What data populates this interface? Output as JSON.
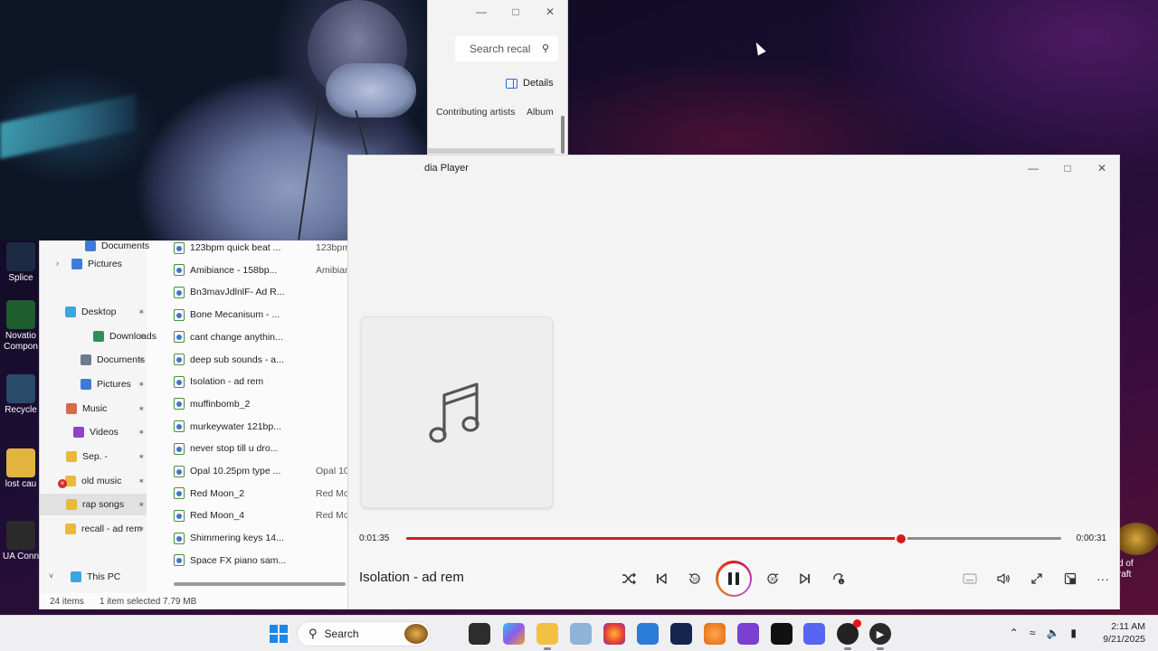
{
  "desktop": {
    "icons": [
      {
        "label": "Splice",
        "color": "#1d2a44"
      },
      {
        "label": "Novatio Compon",
        "color": "#1d5d2e"
      },
      {
        "label": "Recycle",
        "color": "#2a4a6a"
      },
      {
        "label": "lost cau",
        "color": "#e3b341"
      },
      {
        "label": "UA Conn",
        "color": "#2a2a2a"
      }
    ],
    "right_icon_label": "d of\nraft"
  },
  "top_explorer": {
    "search_placeholder": "Search recal",
    "details_label": "Details",
    "columns": [
      "Contributing artists",
      "Album"
    ]
  },
  "explorer": {
    "nav_items": [
      {
        "label": "Documents",
        "icon_color": "#3d7bd9",
        "pinned": false
      },
      {
        "label": "Pictures",
        "icon_color": "#3d7bd9",
        "pinned": false
      },
      {
        "label": "Desktop",
        "icon_color": "#3aa5de",
        "pinned": true
      },
      {
        "label": "Downloads",
        "icon_color": "#2e8f5c",
        "pinned": true
      },
      {
        "label": "Documents",
        "icon_color": "#6d7b8d",
        "pinned": true
      },
      {
        "label": "Pictures",
        "icon_color": "#3d7bd9",
        "pinned": true
      },
      {
        "label": "Music",
        "icon_color": "#d46b4a",
        "pinned": true
      },
      {
        "label": "Videos",
        "icon_color": "#8c44c8",
        "pinned": true
      },
      {
        "label": "Sep. -",
        "icon_color": "#e9b93a",
        "pinned": true
      },
      {
        "label": "old music",
        "icon_color": "#e9b93a",
        "pinned": true
      },
      {
        "label": "rap songs",
        "icon_color": "#e9b93a",
        "pinned": true
      },
      {
        "label": "recall - ad rem",
        "icon_color": "#e9b93a",
        "pinned": true
      },
      {
        "label": "This PC",
        "icon_color": "#3aa5de",
        "pinned": false
      }
    ],
    "files": [
      {
        "name": "123bpm quick beat ...",
        "album": "123bpm"
      },
      {
        "name": "Amibiance - 158bp...",
        "album": "Amibian"
      },
      {
        "name": "Bn3mavJdlnlF- Ad R...",
        "album": ""
      },
      {
        "name": "Bone Mecanisum - ...",
        "album": ""
      },
      {
        "name": "cant change anythin...",
        "album": ""
      },
      {
        "name": "deep sub sounds - a...",
        "album": ""
      },
      {
        "name": "Isolation - ad rem",
        "album": ""
      },
      {
        "name": "muffinbomb_2",
        "album": ""
      },
      {
        "name": "murkeywater 121bp...",
        "album": ""
      },
      {
        "name": "never stop till u dro...",
        "album": ""
      },
      {
        "name": "Opal 10.25pm type ...",
        "album": "Opal 10."
      },
      {
        "name": "Red Moon_2",
        "album": "Red Moo"
      },
      {
        "name": "Red Moon_4",
        "album": "Red Moo"
      },
      {
        "name": "Shimmering keys 14...",
        "album": ""
      },
      {
        "name": "Space FX piano sam...",
        "album": ""
      }
    ],
    "status_count": "24 items",
    "status_selected": "1 item selected  7.79 MB"
  },
  "player": {
    "title": "dia Player",
    "elapsed": "0:01:35",
    "remaining": "0:00:31",
    "progress": 0.755,
    "track": "Isolation - ad rem",
    "accent": "#d81c1c"
  },
  "taskbar": {
    "search_label": "Search",
    "time": "2:11 AM",
    "date": "9/21/2025"
  }
}
